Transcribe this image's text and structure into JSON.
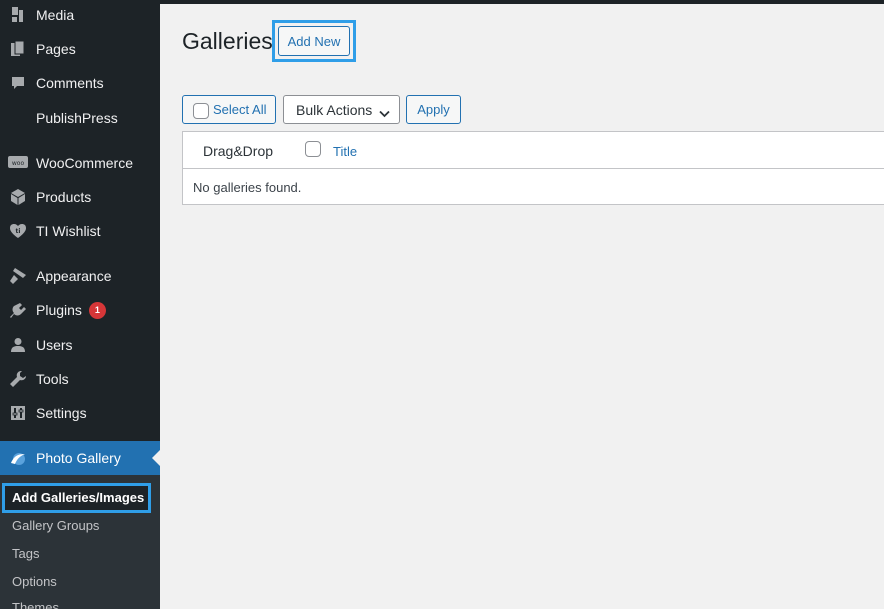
{
  "sidebar": {
    "items": [
      {
        "label": "Media",
        "icon": "media-icon"
      },
      {
        "label": "Pages",
        "icon": "pages-icon"
      },
      {
        "label": "Comments",
        "icon": "comments-icon"
      },
      {
        "label": "PublishPress",
        "icon": ""
      },
      {
        "label": "WooCommerce",
        "icon": "woocommerce-icon"
      },
      {
        "label": "Products",
        "icon": "products-icon"
      },
      {
        "label": "TI Wishlist",
        "icon": "heart-icon"
      },
      {
        "label": "Appearance",
        "icon": "paintbrush-icon"
      },
      {
        "label": "Plugins",
        "icon": "plugin-icon",
        "badge": "1"
      },
      {
        "label": "Users",
        "icon": "users-icon"
      },
      {
        "label": "Tools",
        "icon": "wrench-icon"
      },
      {
        "label": "Settings",
        "icon": "settings-icon"
      },
      {
        "label": "Photo Gallery",
        "icon": "photo-gallery-icon",
        "active": true
      }
    ],
    "submenu": [
      {
        "label": "Add Galleries/Images",
        "current": true
      },
      {
        "label": "Gallery Groups"
      },
      {
        "label": "Tags"
      },
      {
        "label": "Options"
      },
      {
        "label": "Themes"
      }
    ]
  },
  "main": {
    "title": "Galleries",
    "add_new_label": "Add New",
    "select_all_label": "Select All",
    "bulk_actions_label": "Bulk Actions",
    "apply_label": "Apply",
    "table": {
      "columns": [
        "Drag&Drop",
        "Title"
      ],
      "empty_message": "No galleries found."
    }
  },
  "colors": {
    "sidebar_bg": "#1d2327",
    "accent": "#2271b1",
    "highlight_outline": "#2f9ee8",
    "badge": "#d63638"
  }
}
